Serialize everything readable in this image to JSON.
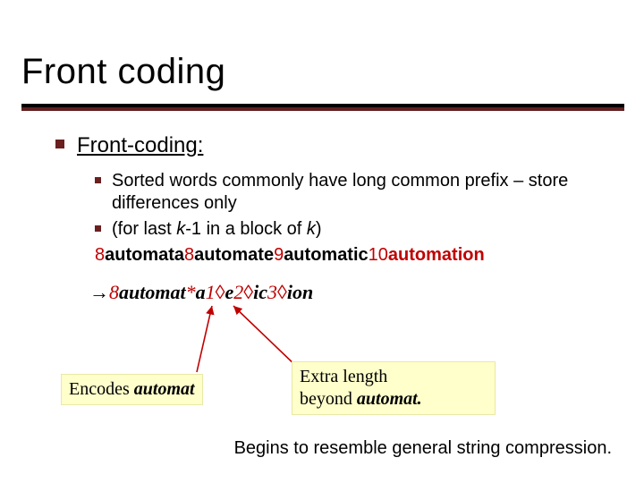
{
  "title": "Front coding",
  "l1": {
    "label": "Front-coding:"
  },
  "l2a": "Sorted words commonly have long common prefix – store differences only",
  "l2b_pre": "(for last ",
  "l2b_k1": "k",
  "l2b_mid": "-1 in a block of ",
  "l2b_k2": "k",
  "l2b_post": ")",
  "ex": {
    "n1": "8",
    "w1": "automata",
    "n2": "8",
    "w2": "automate",
    "n3": "9",
    "w3": "automatic",
    "n4": "10",
    "w4": "automation"
  },
  "enc": {
    "arrow": "→",
    "n0": "8",
    "stem": "automat",
    "star": "*",
    "s1": "a",
    "d1": "1",
    "diamond": "◊",
    "s2": "e",
    "d2": "2",
    "s3": "ic",
    "d3": "3",
    "s4": "ion"
  },
  "note1_pre": "Encodes ",
  "note1_word": "automat",
  "note2_line1": "Extra length",
  "note2_line2_pre": "beyond ",
  "note2_word": "automat.",
  "footer": "Begins to resemble general string compression."
}
